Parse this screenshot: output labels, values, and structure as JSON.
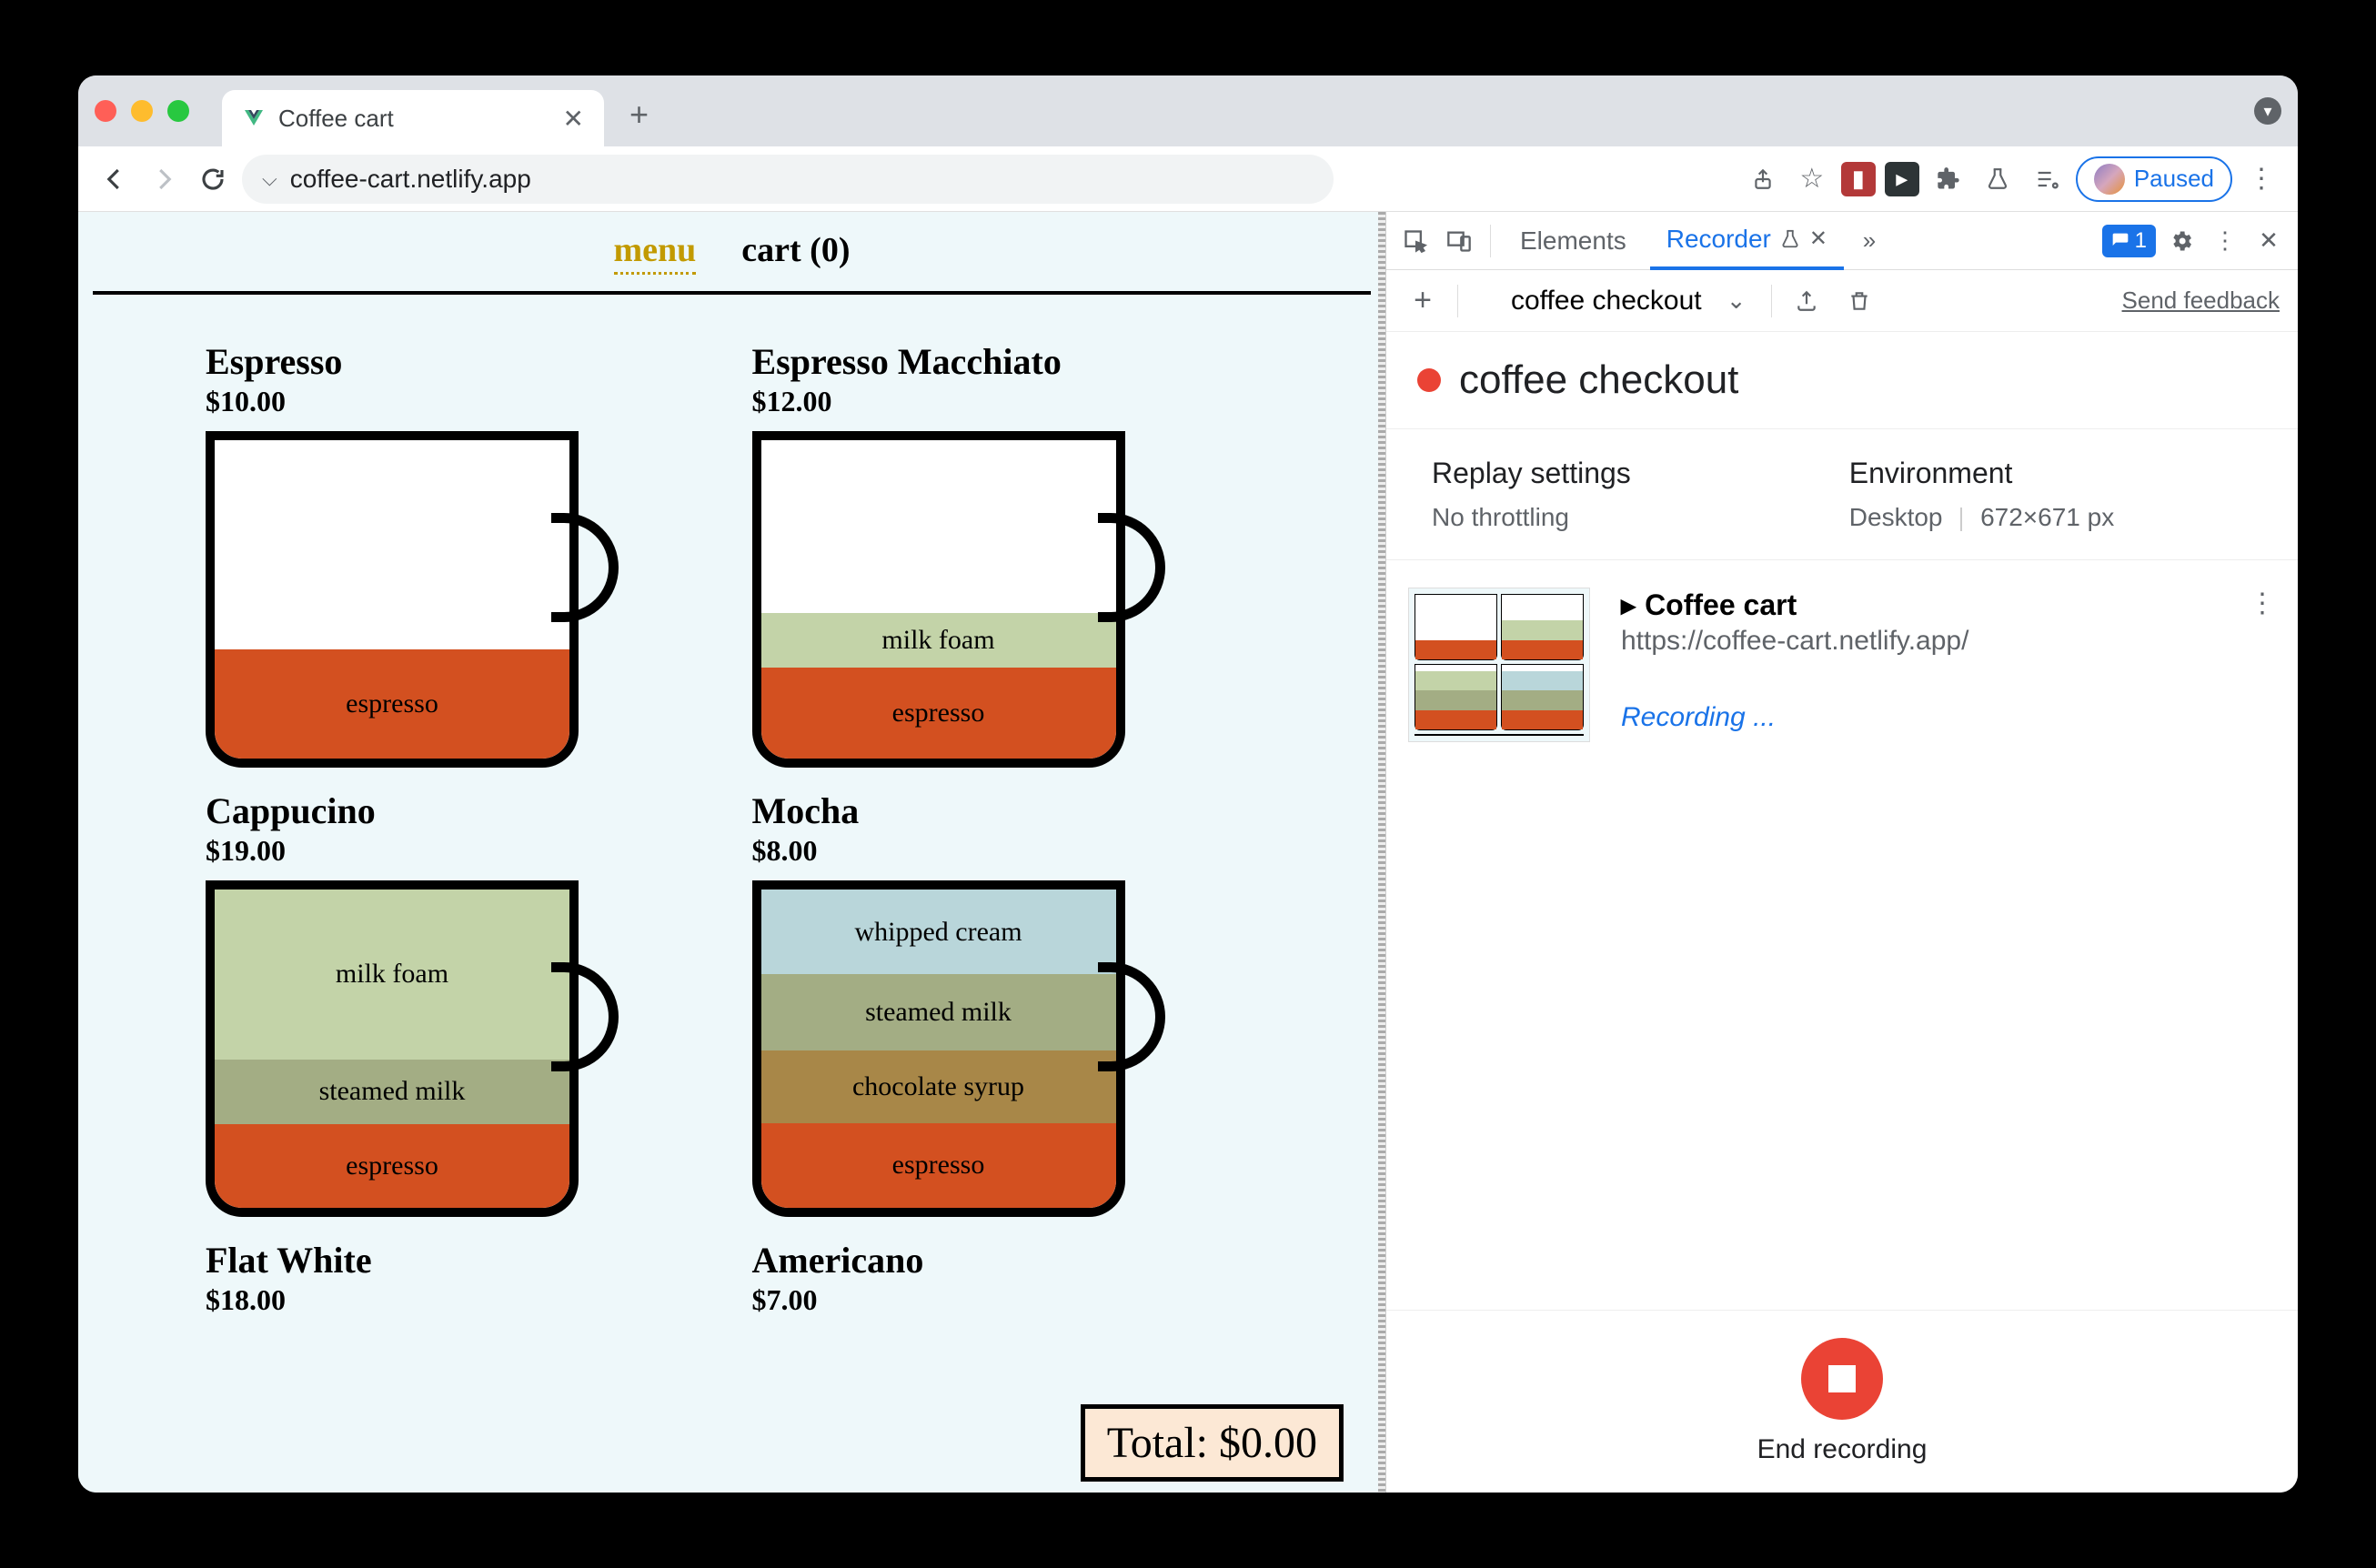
{
  "browser": {
    "tab_title": "Coffee cart",
    "url": "coffee-cart.netlify.app",
    "profile_state": "Paused"
  },
  "page": {
    "nav": {
      "menu": "menu",
      "cart": "cart (0)"
    },
    "products": [
      {
        "name": "Espresso",
        "price": "$10.00",
        "layers": [
          {
            "label": "espresso",
            "class": "espresso",
            "h": 120
          }
        ]
      },
      {
        "name": "Espresso Macchiato",
        "price": "$12.00",
        "layers": [
          {
            "label": "milk foam",
            "class": "milkfoam",
            "h": 60
          },
          {
            "label": "espresso",
            "class": "espresso",
            "h": 100
          }
        ]
      },
      {
        "name": "Cappucino",
        "price": "$19.00",
        "layers": [
          {
            "label": "milk foam",
            "class": "milkfoam",
            "h": 190
          },
          {
            "label": "steamed milk",
            "class": "steamed",
            "h": 72
          },
          {
            "label": "espresso",
            "class": "espresso",
            "h": 94
          }
        ]
      },
      {
        "name": "Mocha",
        "price": "$8.00",
        "layers": [
          {
            "label": "whipped cream",
            "class": "whipped",
            "h": 94
          },
          {
            "label": "steamed milk",
            "class": "steamed",
            "h": 84
          },
          {
            "label": "chocolate syrup",
            "class": "choco",
            "h": 80
          },
          {
            "label": "espresso",
            "class": "espresso",
            "h": 94
          }
        ]
      },
      {
        "name": "Flat White",
        "price": "$18.00",
        "layers": []
      },
      {
        "name": "Americano",
        "price": "$7.00",
        "layers": []
      }
    ],
    "total": "Total: $0.00"
  },
  "devtools": {
    "tabs": {
      "elements": "Elements",
      "recorder": "Recorder"
    },
    "badge_count": "1",
    "recording_name": "coffee checkout",
    "send_feedback": "Send feedback",
    "header_title": "coffee checkout",
    "settings": {
      "replay_hd": "Replay settings",
      "replay_val": "No throttling",
      "env_hd": "Environment",
      "env_device": "Desktop",
      "env_size": "672×671 px"
    },
    "step": {
      "title": "Coffee cart",
      "url": "https://coffee-cart.netlify.app/",
      "status": "Recording ..."
    },
    "footer": "End recording"
  }
}
